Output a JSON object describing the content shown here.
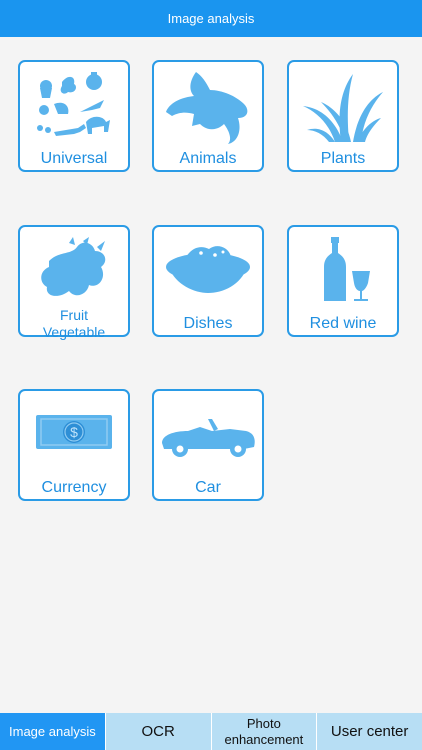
{
  "header": {
    "title": "Image analysis"
  },
  "categories": [
    {
      "label": "Universal",
      "icon": "universal-collage-icon"
    },
    {
      "label": "Animals",
      "icon": "goldfish-icon"
    },
    {
      "label": "Plants",
      "icon": "grass-icon"
    },
    {
      "label_line1": "Fruit",
      "label_line2": "Vegetable",
      "icon": "fruit-vegetable-icon"
    },
    {
      "label": "Dishes",
      "icon": "dish-icon"
    },
    {
      "label": "Red wine",
      "icon": "wine-bottle-glass-icon"
    },
    {
      "label": "Currency",
      "icon": "banknote-icon"
    },
    {
      "label": "Car",
      "icon": "convertible-car-icon"
    }
  ],
  "tabs": [
    {
      "label": "Image analysis"
    },
    {
      "label": "OCR"
    },
    {
      "label_line1": "Photo",
      "label_line2": "enhancement"
    },
    {
      "label": "User center"
    }
  ],
  "colors": {
    "header_bg": "#1a95ef",
    "accent": "#2a9be6",
    "icon": "#5ab3ec",
    "tab_active": "#2196f3",
    "tab_inactive": "#b7def4"
  }
}
